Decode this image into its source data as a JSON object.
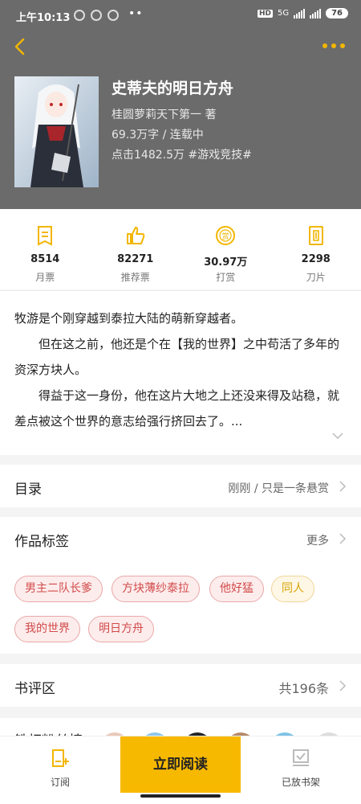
{
  "status_bar": {
    "time": "上午10:13",
    "dots": "••",
    "hd": "HD",
    "network": "5G",
    "battery": "76"
  },
  "book": {
    "title": "史蒂夫的明日方舟",
    "author_line": "桂圆萝莉天下第一  著",
    "words_status": "69.3万字 / 连载中",
    "clicks_genre": "点击1482.5万  #游戏竞技#"
  },
  "stats": [
    {
      "icon": "monthly-ticket-icon",
      "value": "8514",
      "label": "月票"
    },
    {
      "icon": "thumbs-up-icon",
      "value": "82271",
      "label": "推荐票"
    },
    {
      "icon": "reward-coin-icon",
      "value": "30.97万",
      "label": "打赏"
    },
    {
      "icon": "blade-icon",
      "value": "2298",
      "label": "刀片"
    }
  ],
  "intro": {
    "p1": "牧游是个刚穿越到泰拉大陆的萌新穿越者。",
    "p2": "但在这之前，他还是个在【我的世界】之中苟活了多年的资深方块人。",
    "p3": "得益于这一身份，他在这片大地之上还没来得及站稳，就差点被这个世界的意志给强行挤回去了。..."
  },
  "toc": {
    "label": "目录",
    "value": "刚刚 / 只是一条悬赏"
  },
  "tags_section": {
    "label": "作品标签",
    "more": "更多"
  },
  "tags": [
    "男主二队长爹",
    "方块薄纱泰拉",
    "他好猛",
    "同人",
    "我的世界",
    "明日方舟"
  ],
  "reviews": {
    "label": "书评区",
    "value": "共196条"
  },
  "fans": {
    "label": "铁杆粉丝榜"
  },
  "bottom": {
    "subscribe": "订阅",
    "read": "立即阅读",
    "shelf": "已放书架"
  },
  "colors": {
    "accent": "#f7b900",
    "tag_red": "#d24a4a",
    "tag_yellow": "#d6a300"
  }
}
